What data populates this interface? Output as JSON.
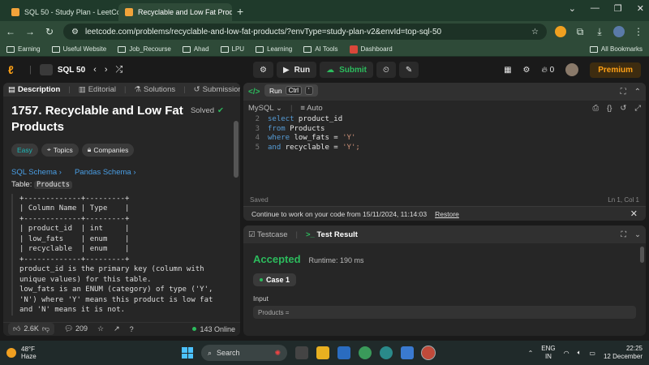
{
  "browser": {
    "tabs": [
      {
        "label": "SQL 50 - Study Plan - LeetCode"
      },
      {
        "label": "Recyclable and Low Fat Products"
      }
    ],
    "url": "leetcode.com/problems/recyclable-and-low-fat-products/?envType=study-plan-v2&envId=top-sql-50",
    "bookmarks": [
      "Earning",
      "Useful Website",
      "Job_Recourse",
      "Ahad",
      "LPU",
      "Learning",
      "AI Tools",
      "Dashboard"
    ],
    "all_bookmarks": "All Bookmarks"
  },
  "header": {
    "study_plan": "SQL 50",
    "run_label": "Run",
    "submit_label": "Submit",
    "fire_count": "0",
    "premium": "Premium"
  },
  "left": {
    "tabs": [
      "Description",
      "Editorial",
      "Solutions",
      "Submissions"
    ],
    "title": "1757. Recyclable and Low Fat Products",
    "solved": "Solved",
    "chips": [
      "Easy",
      "Topics",
      "Companies"
    ],
    "schemas": [
      "SQL Schema",
      "Pandas Schema"
    ],
    "table_label": "Table:",
    "table_name": "Products",
    "description": "+-------------+---------+\n| Column Name | Type    |\n+-------------+---------+\n| product_id  | int     |\n| low_fats    | enum    |\n| recyclable  | enum    |\n+-------------+---------+\nproduct_id is the primary key (column with\nunique values) for this table.\nlow_fats is an ENUM (category) of type ('Y',\n'N') where 'Y' means this product is low fat\nand 'N' means it is not.",
    "likes": "2.6K",
    "comments": "209",
    "online": "143 Online"
  },
  "editor": {
    "tooltip_label": "Run",
    "tooltip_key1": "Ctrl",
    "tooltip_key2": "'",
    "language": "MySQL",
    "auto": "Auto",
    "lines": [
      {
        "n": "2",
        "kw": "select",
        "rest": " product_id",
        "str": ""
      },
      {
        "n": "3",
        "kw": "from",
        "rest": " Products",
        "str": ""
      },
      {
        "n": "4",
        "kw": "where",
        "rest": " low_fats = ",
        "str": "'Y'"
      },
      {
        "n": "5",
        "kw": "and",
        "rest": " recyclable = ",
        "str": "'Y';"
      }
    ],
    "saved": "Saved",
    "cursor": "Ln 1, Col 1",
    "restore_msg": "Continue to work on your code from 15/11/2024, 11:14:03",
    "restore_link": "Restore"
  },
  "results": {
    "tabs": [
      "Testcase",
      "Test Result"
    ],
    "status": "Accepted",
    "runtime": "Runtime: 190 ms",
    "case": "Case 1",
    "input_label": "Input",
    "input_value": "Products ="
  },
  "taskbar": {
    "temp": "48°F",
    "weather": "Haze",
    "search": "Search",
    "lang1": "ENG",
    "lang2": "IN",
    "time": "22:25",
    "date": "12 December"
  }
}
